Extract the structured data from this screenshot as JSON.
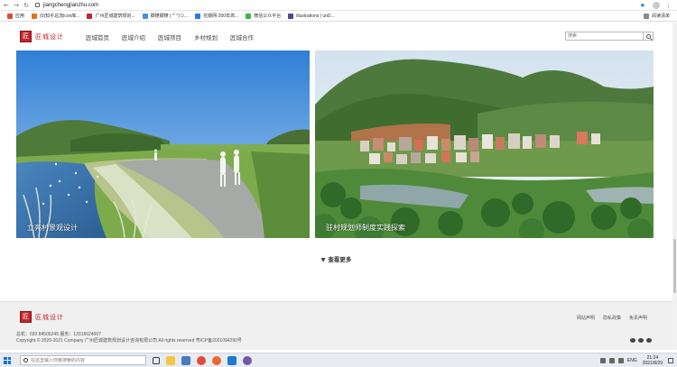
{
  "browser": {
    "url": "jiangchengjianzhu.com",
    "bookmarks": [
      {
        "label": "应用",
        "color": "#e04b3c"
      },
      {
        "label": "(0)知乎总流icon库...",
        "color": "#e0721e"
      },
      {
        "label": "广州匠城建筑规划...",
        "color": "#c1272d"
      },
      {
        "label": "脚镣脚镣 | °ﾟ°)つ...",
        "color": "#4a90d9"
      },
      {
        "label": "花瓣网-200年高...",
        "color": "#2a7be4"
      },
      {
        "label": "微信公众平台",
        "color": "#3fb34f"
      },
      {
        "label": "illustrations | unD...",
        "color": "#4a4a8c"
      }
    ],
    "reading_list": "阅读清单"
  },
  "site": {
    "logo_char": "匠",
    "logo_text": "匠城设计",
    "nav": [
      "匠城首页",
      "匠城介绍",
      "匠城项目",
      "乡村规划",
      "匠城合作"
    ],
    "search_placeholder": "搜索"
  },
  "cards": [
    {
      "caption": "立亮村景观设计"
    },
    {
      "caption": "驻村规划师制度实践探索"
    }
  ],
  "load_more": "查看更多",
  "footer": {
    "links": [
      "网站声明",
      "隐私政策",
      "免责声明"
    ],
    "contact": "总机：020 84506245  服务：13316624007",
    "copyright": "Copyright © 2020-2021 Company 广州匠城建筑规划设计咨询有限公司 All rights reserved 粤ICP备2021094290号"
  },
  "taskbar": {
    "search_placeholder": "在这里输入你要搜索的内容",
    "lang": "ENG",
    "time": "21:24",
    "date": "2021/8/29"
  }
}
